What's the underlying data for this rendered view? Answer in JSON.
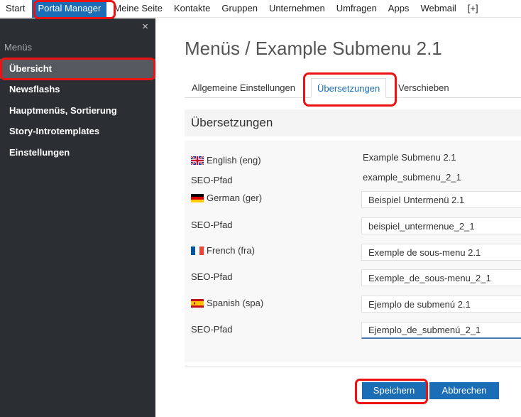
{
  "topnav": {
    "items": [
      "Start",
      "Portal Manager",
      "Meine Seite",
      "Kontakte",
      "Gruppen",
      "Unternehmen",
      "Umfragen",
      "Apps",
      "Webmail",
      "[+]"
    ]
  },
  "sidebar": {
    "close": "×",
    "heading": "Menüs",
    "items": [
      "Übersicht",
      "Newsflashs",
      "Hauptmenüs, Sortierung",
      "Story-Introtemplates",
      "Einstellungen"
    ]
  },
  "main": {
    "title": "Menüs / Example Submenu 2.1",
    "tabs": [
      "Allgemeine Einstellungen",
      "Übersetzungen",
      "Verschieben"
    ],
    "section_title": "Übersetzungen",
    "rows": [
      {
        "lang_label": "English (eng)",
        "flag": "uk-flag-icon",
        "title_value": "Example Submenu 2.1",
        "seo_label": "SEO-Pfad",
        "seo_value": "example_submenu_2_1"
      },
      {
        "lang_label": "German (ger)",
        "flag": "german-flag-icon",
        "title_value": "Beispiel Untermenü 2.1",
        "seo_label": "SEO-Pfad",
        "seo_value": "beispiel_untermenue_2_1"
      },
      {
        "lang_label": "French (fra)",
        "flag": "french-flag-icon",
        "title_value": "Exemple de sous-menu 2.1",
        "seo_label": "SEO-Pfad",
        "seo_value": "Exemple_de_sous-menu_2_1"
      },
      {
        "lang_label": "Spanish (spa)",
        "flag": "spanish-flag-icon",
        "title_value": "Ejemplo de submenú 2.1",
        "seo_label": "SEO-Pfad",
        "seo_value": "Ejemplo_de_submenú_2_1"
      }
    ],
    "buttons": {
      "save": "Speichern",
      "cancel": "Abbrechen"
    }
  },
  "colors": {
    "accent": "#1b6eb5",
    "sidebar_bg": "#2b2f33",
    "highlight": "#ee1111"
  }
}
